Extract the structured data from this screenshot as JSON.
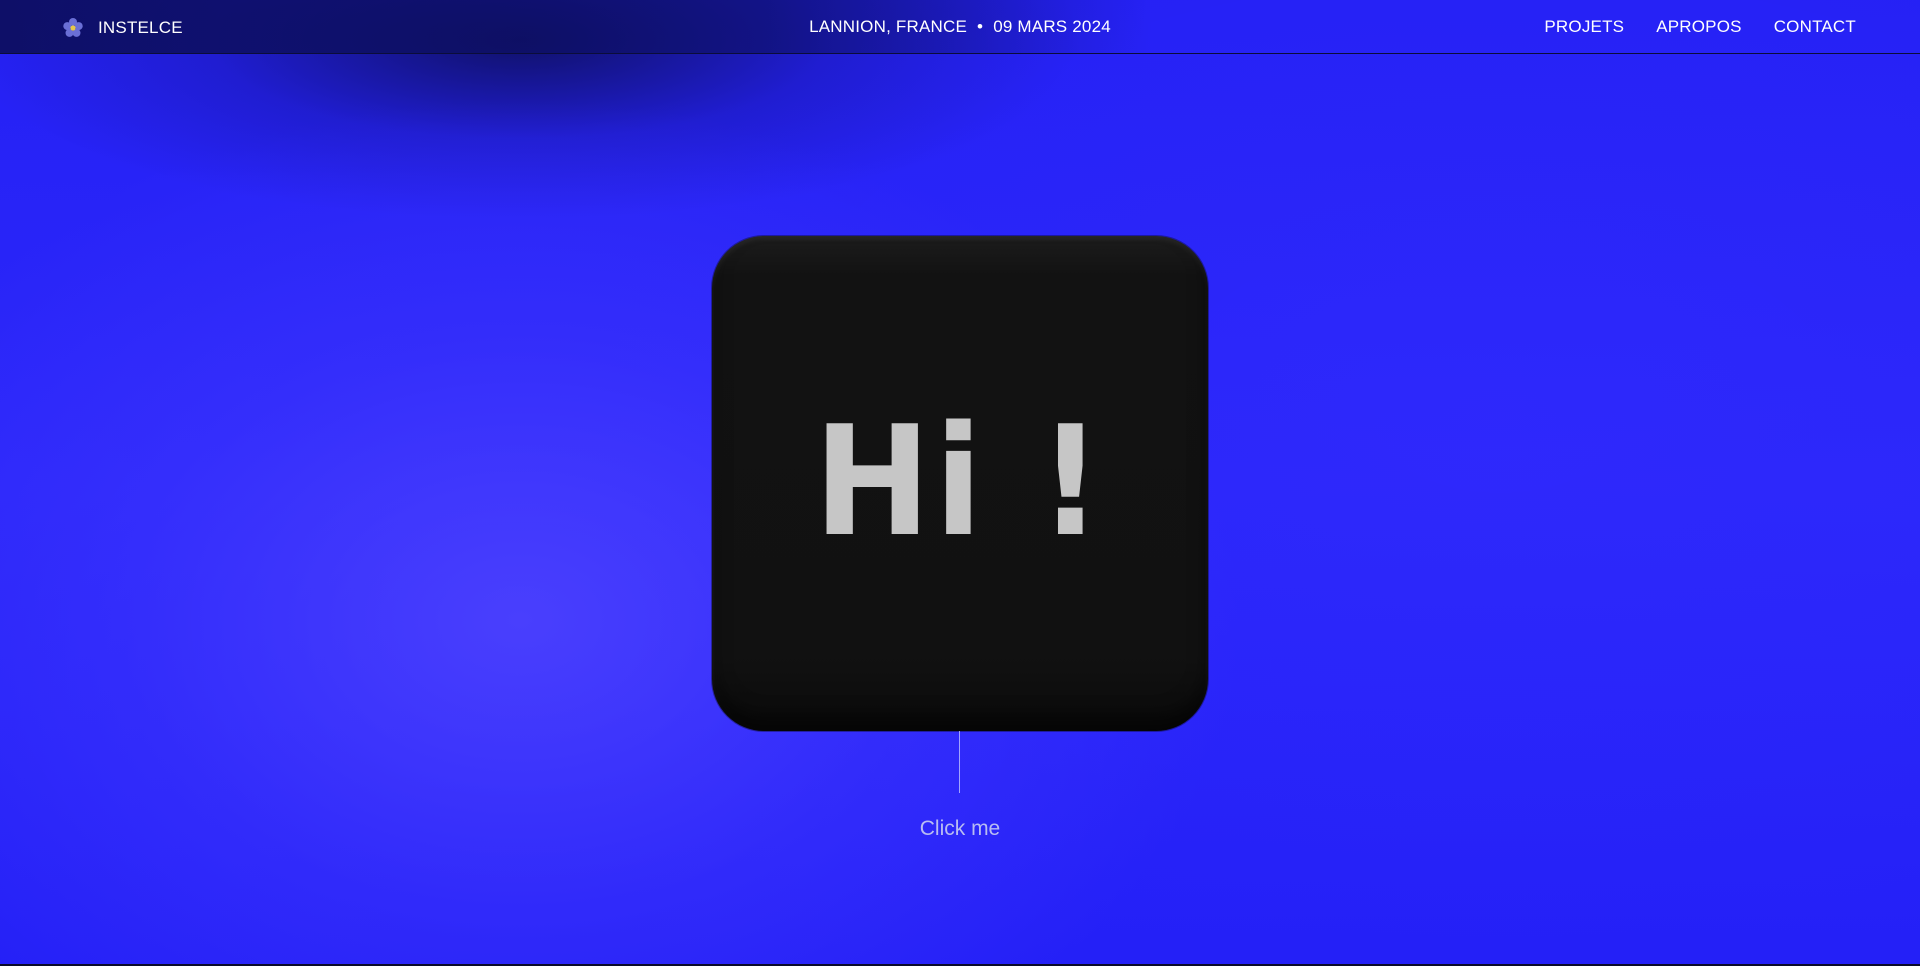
{
  "header": {
    "brand_name": "INSTELCE",
    "brand_icon": "flower-icon",
    "location": "LANNION, FRANCE",
    "separator": "•",
    "date": "09 MARS 2024",
    "nav": [
      {
        "label": "PROJETS"
      },
      {
        "label": "APROPOS"
      },
      {
        "label": "CONTACT"
      }
    ]
  },
  "main": {
    "card_text": "Hi !",
    "cta_label": "Click me"
  },
  "colors": {
    "background": "#2420f7",
    "card": "#111111",
    "card_text": "#c6c6c6",
    "header_text": "#ffffff",
    "cta_text": "#b8bcf2"
  }
}
